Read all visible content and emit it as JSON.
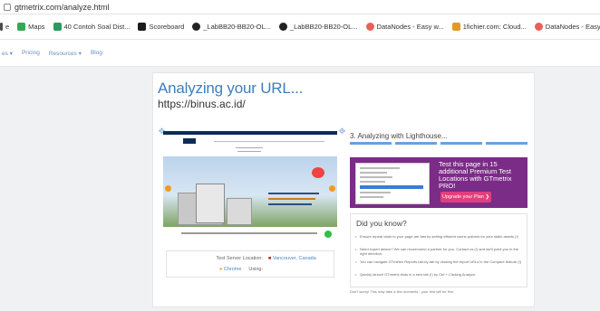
{
  "browser": {
    "address": "gtmetrix.com/analyze.html"
  },
  "bookmarks": [
    {
      "label": "e",
      "icon": "partial-icon",
      "color": "#4b4b4b"
    },
    {
      "label": "Maps",
      "icon": "maps-icon",
      "color": "#34a853"
    },
    {
      "label": "40 Contoh Soal Dist...",
      "icon": "spreadsheet-icon",
      "color": "#2c9b5f"
    },
    {
      "label": "Scoreboard",
      "icon": "dj-icon",
      "color": "#1d1d1d"
    },
    {
      "label": "_LabBB20-BB20-OL...",
      "icon": "github-icon",
      "color": "#222222"
    },
    {
      "label": "_LabBB20-BB20-OL...",
      "icon": "github-icon",
      "color": "#222222"
    },
    {
      "label": "DataNodes - Easy w...",
      "icon": "datanodes-icon",
      "color": "#e8615a"
    },
    {
      "label": "1fichier.com: Cloud...",
      "icon": "fichier-icon",
      "color": "#e09a2a"
    },
    {
      "label": "DataNodes - Easy w...",
      "icon": "datanodes-icon",
      "color": "#e8615a"
    }
  ],
  "sitenav": {
    "items": [
      "es ▾",
      "Pricing",
      "Resources ▾",
      "Blog"
    ]
  },
  "main": {
    "title": "Analyzing your URL...",
    "url": "https://binus.ac.id/"
  },
  "server": {
    "location_label": "Test Server Location:",
    "location_value": "Vancouver, Canada",
    "using_label": "Using:",
    "using_value": "Chrome"
  },
  "lighthouse": {
    "step": "3. Analyzing with Lighthouse..."
  },
  "promo": {
    "text": "Test this page in 15 additional Premium Test Locations with GTmetrix PRO!",
    "cta": "Upgrade your Plan ❯"
  },
  "did_you_know": {
    "heading": "Did you know?",
    "tips": [
      "Ensure repeat visits to your page are fast by setting efficient cache policies for your static assets (!)",
      "Need expert advice? We can recommend a partner for you. Contact us (!) and we'll point you in the right direction.",
      "You can navigate GTmetrix Reports tab-by-tab by clicking the report URLs in the Compare feature (!)",
      "Quickly launch GTmetrix tests in a new tab (!) by Ctrl + Clicking Analyze."
    ]
  },
  "note": "Don't worry! This may take a few moments - your test will be fine."
}
